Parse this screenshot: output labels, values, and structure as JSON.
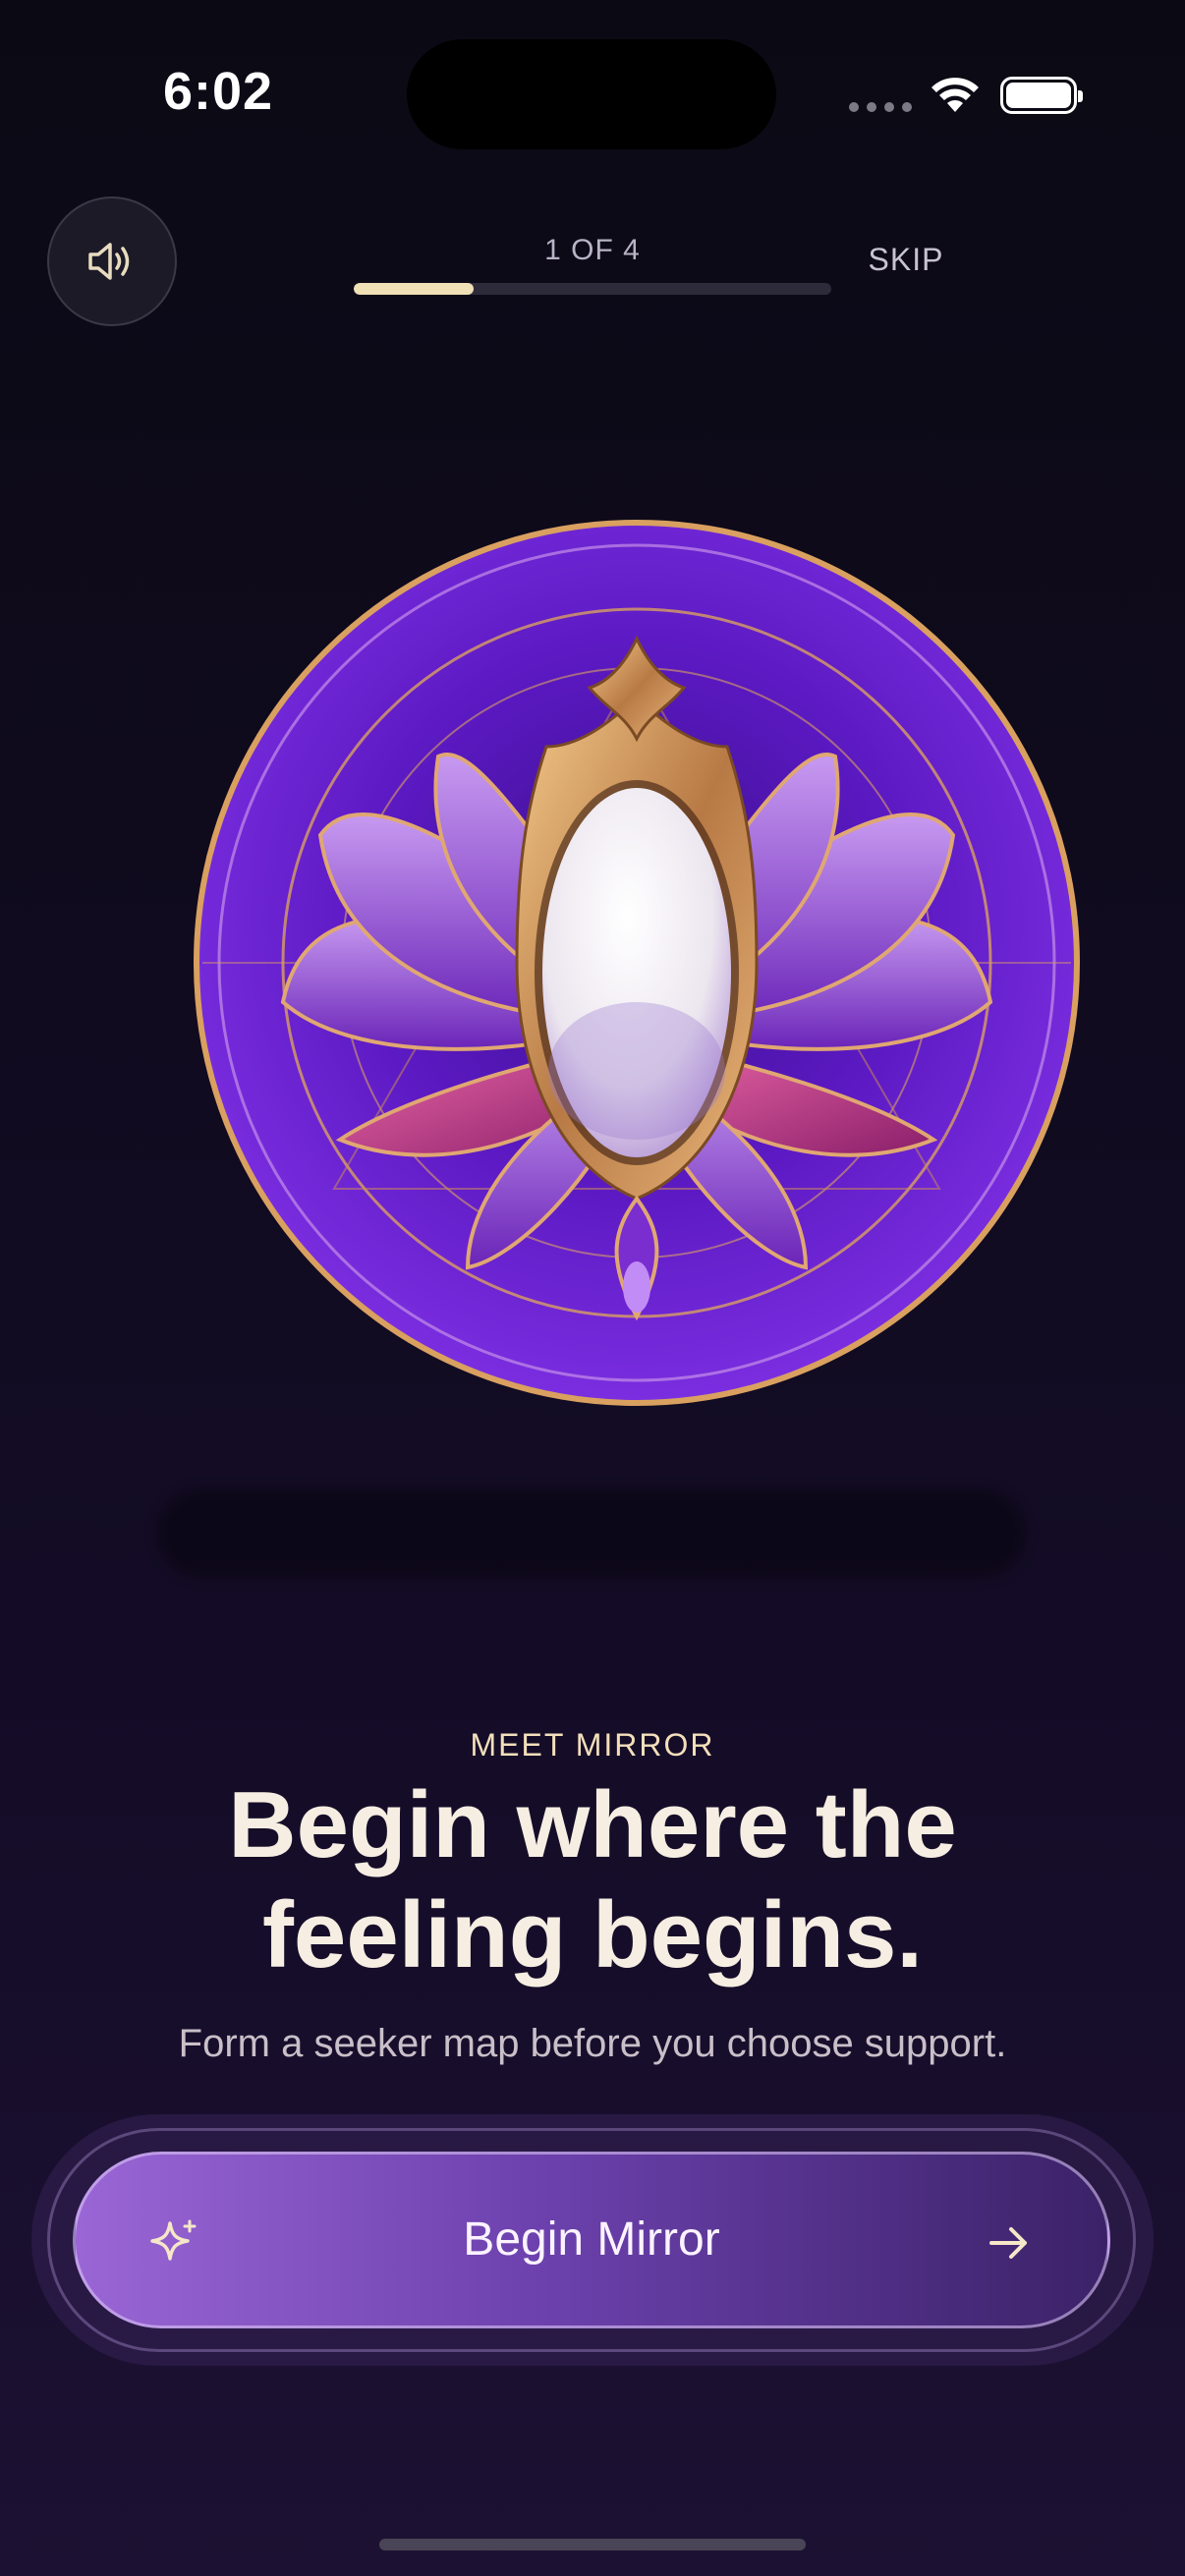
{
  "status_bar": {
    "time": "6:02"
  },
  "header": {
    "progress_label": "1 OF 4",
    "progress_fraction": 0.25,
    "skip_label": "SKIP"
  },
  "content": {
    "eyebrow": "MEET MIRROR",
    "headline_line1": "Begin where the",
    "headline_line2": "feeling begins.",
    "subline": "Form a seeker map before you choose support."
  },
  "cta": {
    "label": "Begin Mirror"
  },
  "icons": {
    "sound": "speaker-icon",
    "sparkle": "sparkle-icon",
    "arrow": "arrow-right-icon",
    "hero": "lotus-mirror-emblem"
  },
  "colors": {
    "accent_gold": "#f0e0b6",
    "cta_start": "#9a66d6",
    "cta_end": "#3b2268",
    "emblem_purple": "#7a1fd6"
  }
}
